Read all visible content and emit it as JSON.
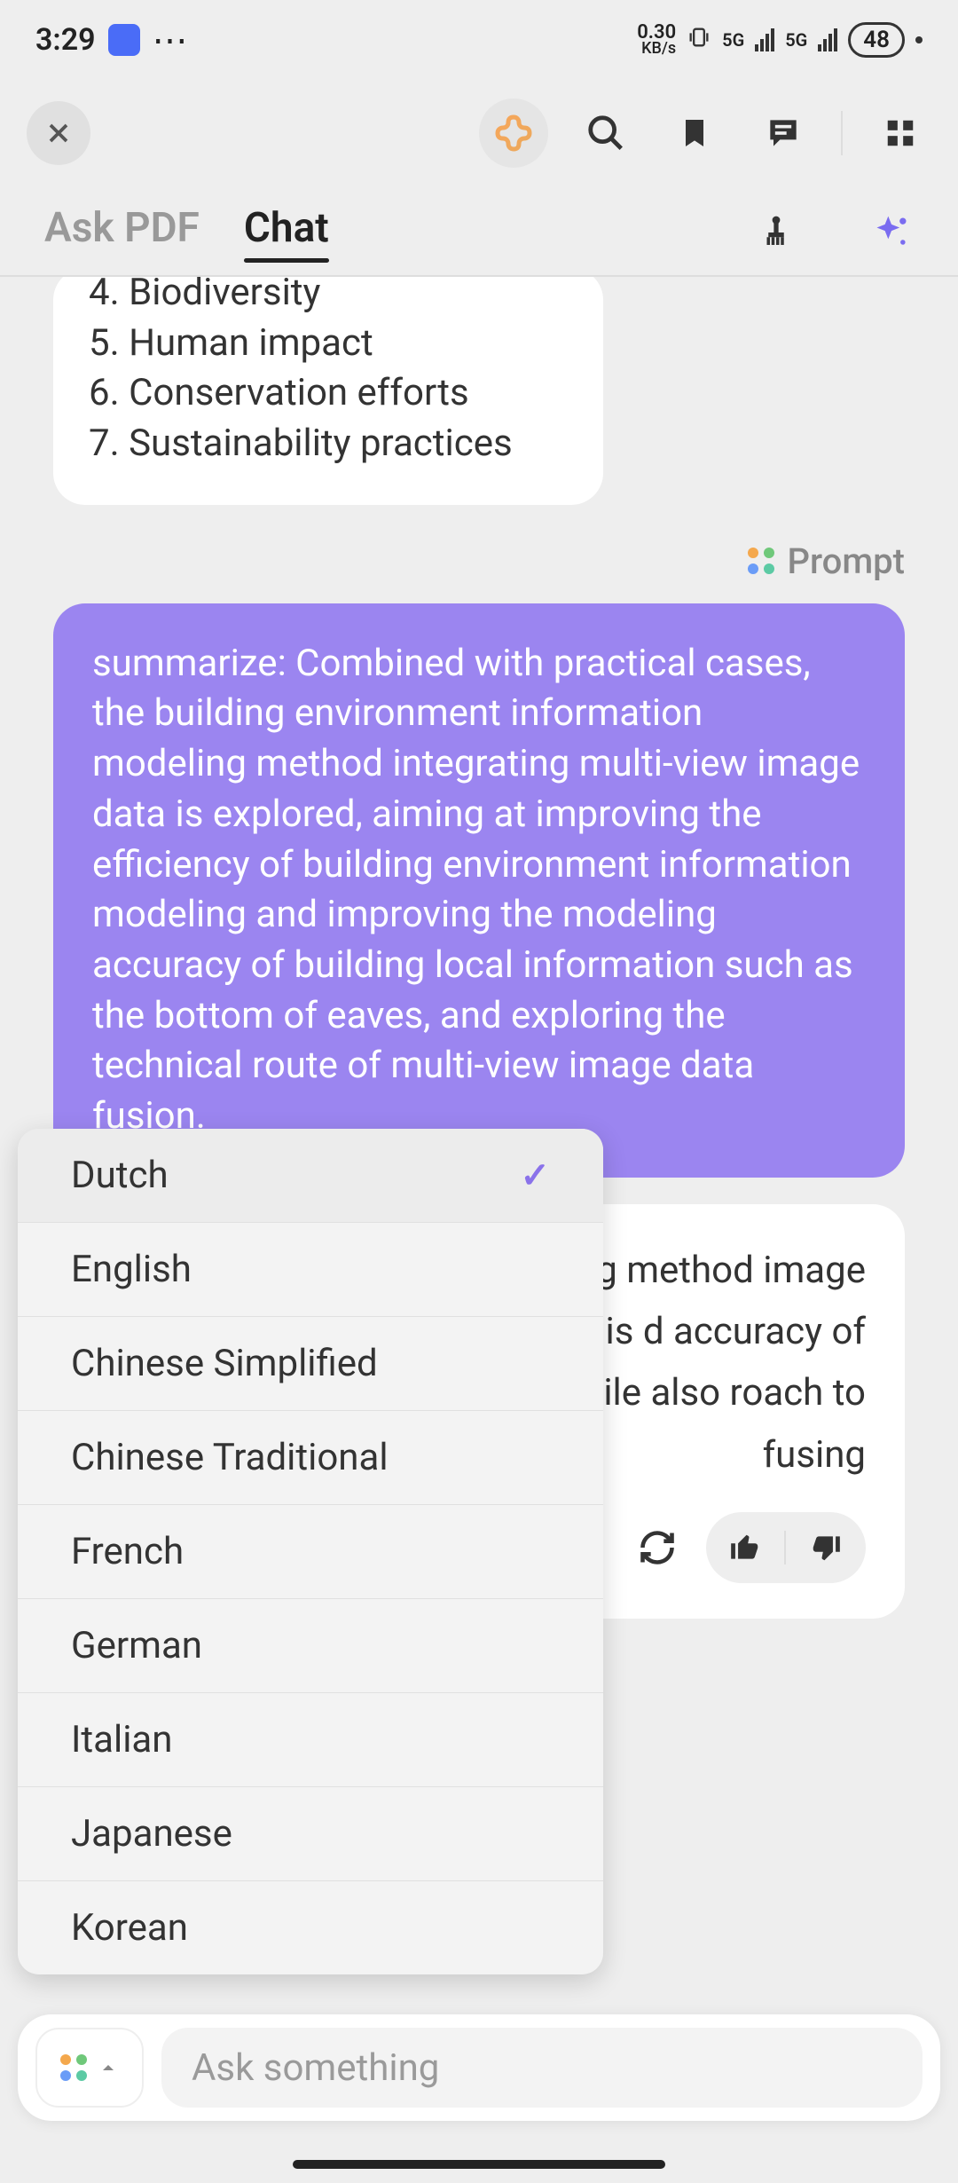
{
  "status": {
    "time": "3:29",
    "rate_value": "0.30",
    "rate_unit": "KB/s",
    "net_label": "5G",
    "battery": "48"
  },
  "tabs": {
    "ask_pdf": "Ask PDF",
    "chat": "Chat"
  },
  "list_card": {
    "items": [
      "4. Biodiversity",
      "5. Human impact",
      "6. Conservation efforts",
      "7. Sustainability practices"
    ]
  },
  "prompt_label": "Prompt",
  "user_message": "summarize: Combined with practical cases, the building environment information modeling method integrating multi-view image data is explored, aiming at improving the efficiency of building environment information modeling and improving the modeling accuracy of building local information such as the bottom of eaves, and exploring the technical route of multi-view image data fusion.",
  "assistant_message_visible": "ding deling method image data, The goal is d accuracy of buildings, , while also roach to fusing",
  "languages": {
    "selected_index": 0,
    "options": [
      "Dutch",
      "English",
      "Chinese Simplified",
      "Chinese Traditional",
      "French",
      "German",
      "Italian",
      "Japanese",
      "Korean"
    ]
  },
  "input": {
    "placeholder": "Ask something"
  }
}
